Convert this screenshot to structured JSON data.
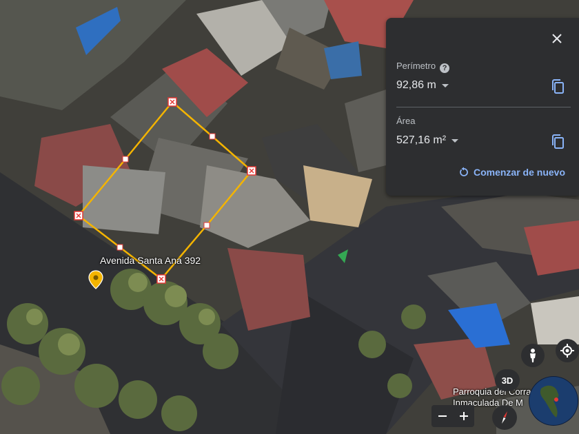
{
  "panel": {
    "perimeter_label": "Perímetro",
    "perimeter_value": "92,86 m",
    "area_label": "Área",
    "area_value": "527,16 m²",
    "restart_label": "Comenzar de nuevo"
  },
  "map": {
    "place_label": "Avenida Santa Ana 392",
    "poi_line1": "Parroquia del Corra",
    "poi_line2": "Inmaculada De M",
    "mode_3d_label": "3D"
  },
  "colors": {
    "measure_line": "#f4b400",
    "marker": "#e53935",
    "panel_bg": "#2d2e30",
    "link": "#8ab4f8",
    "pin": "#f4b400"
  },
  "icons": [
    "close-icon",
    "help-icon",
    "copy-icon",
    "restart-icon",
    "location-pin-icon",
    "pegman-icon",
    "my-location-icon",
    "compass-icon",
    "globe-icon",
    "zoom-in-icon",
    "zoom-out-icon"
  ]
}
